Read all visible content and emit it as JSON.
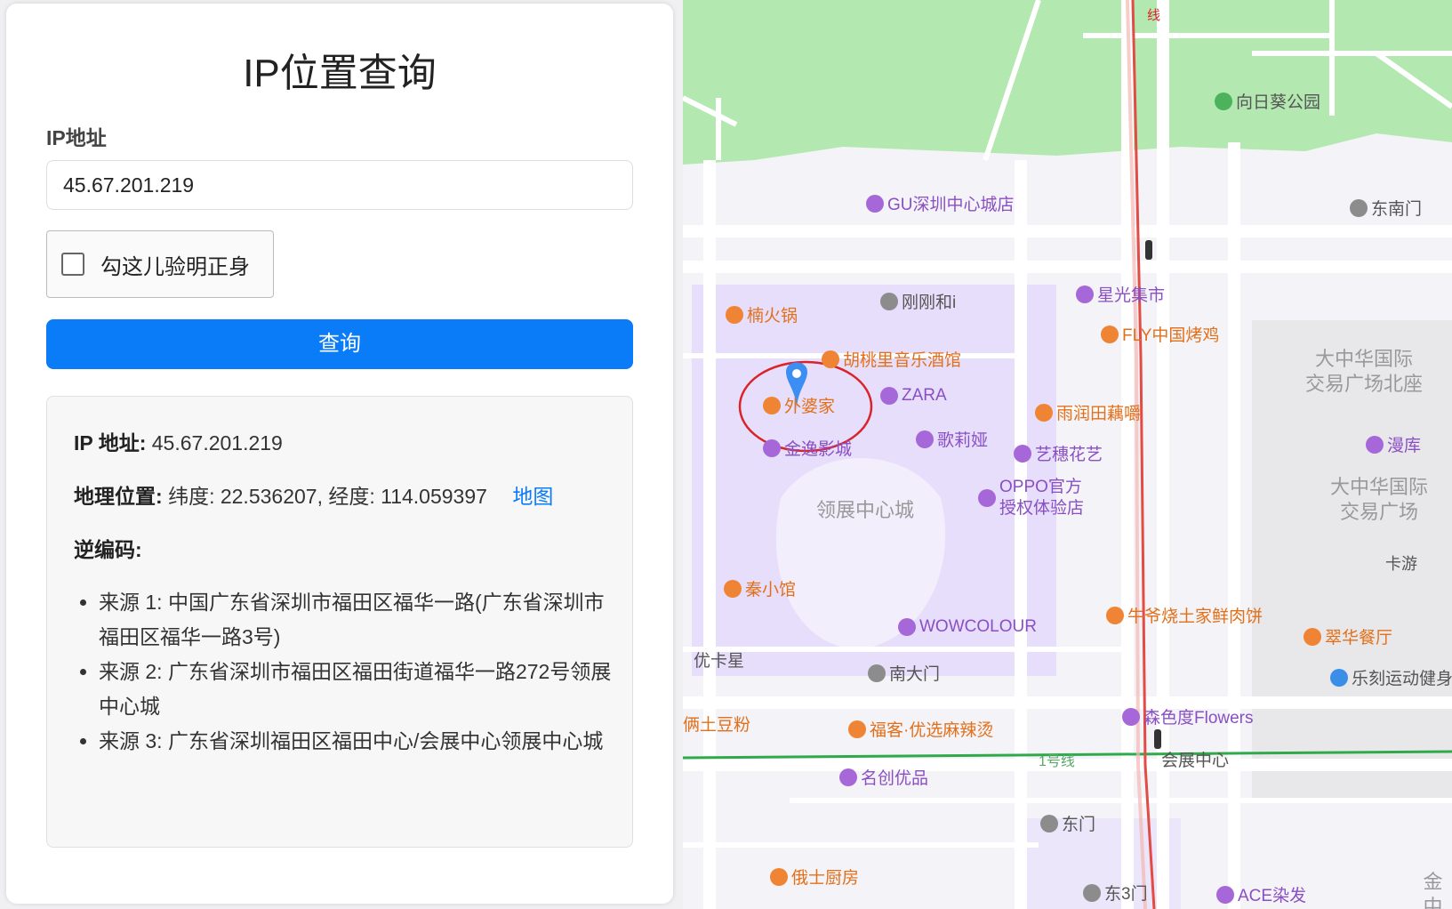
{
  "form": {
    "title": "IP位置查询",
    "ip_label": "IP地址",
    "ip_value": "45.67.201.219",
    "captcha_label": "勾这儿验明正身",
    "submit_label": "查询"
  },
  "result": {
    "ip_key": "IP 地址:",
    "ip_value": "45.67.201.219",
    "geo_key": "地理位置:",
    "geo_value": "纬度: 22.536207, 经度: 114.059397",
    "map_link": "地图",
    "reverse_key": "逆编码:",
    "sources": [
      "来源 1: 中国广东省深圳市福田区福华一路(广东省深圳市福田区福华一路3号)",
      "来源 2: 广东省深圳市福田区福田街道福华一路272号领展中心城",
      "来源 3: 广东省深圳福田区福田中心/会展中心领展中心城"
    ]
  },
  "map": {
    "marker_color": "#3d8ef2",
    "circle_color": "#d9242a",
    "pois": {
      "park": "向日葵公园",
      "gu": "GU深圳中心城店",
      "dongnanmen": "东南门",
      "gangganghe": "刚刚和i",
      "xingguang": "星光集市",
      "nanhuo": "楠火锅",
      "fly": "FLY中国烤鸡",
      "hutao": "胡桃里音乐酒馆",
      "waipo": "外婆家",
      "zara": "ZARA",
      "yurun": "雨润田藕嚼",
      "jinyi": "金逸影城",
      "gelia": "歌莉娅",
      "yisui": "艺穗花艺",
      "oppo1": "OPPO官方",
      "oppo2": "授权体验店",
      "lingzhan": "领展中心城",
      "dazhonghua_north1": "大中华国际",
      "dazhonghua_north2": "交易广场北座",
      "manku": "漫库",
      "dazhonghua1": "大中华国际",
      "dazhonghua2": "交易广场",
      "kayou": "卡游",
      "qinxiaoguan": "秦小馆",
      "niuye": "牛爷烧土家鲜肉饼",
      "wowcolour": "WOWCOLOUR",
      "cuihua": "翠华餐厅",
      "youkaxing": "优卡星",
      "nandamen": "南大门",
      "leke": "乐刻运动健身",
      "liangtudoufen": "俩土豆粉",
      "fuke": "福客·优选麻辣烫",
      "senshe": "森色度Flowers",
      "line1": "1号线",
      "huizhan": "会展中心",
      "mingchuang": "名创优品",
      "dongmen": "东门",
      "eshi": "俄士厨房",
      "dong3men": "东3门",
      "ace": "ACE染发",
      "jinzhong": "金中",
      "xian": "线"
    }
  }
}
